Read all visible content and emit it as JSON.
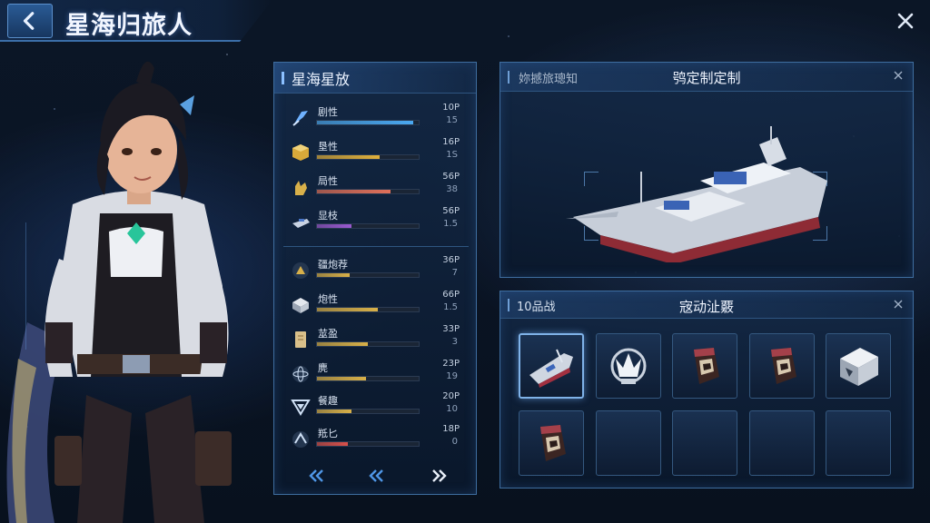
{
  "header": {
    "title": "星海归旅人"
  },
  "stats_panel": {
    "title": "星海星放",
    "stats": [
      {
        "name": "剧性",
        "value": "10P",
        "sub": "15",
        "fill": 0.95,
        "color": "#4aa8f0"
      },
      {
        "name": "垦性",
        "value": "16P",
        "sub": "1S",
        "fill": 0.62,
        "color": "#e0b03c"
      },
      {
        "name": "局性",
        "value": "56P",
        "sub": "38",
        "fill": 0.72,
        "color": "#e0705a"
      },
      {
        "name": "显枝",
        "value": "56P",
        "sub": "1.5",
        "fill": 0.34,
        "color": "#9a5ad0"
      },
      {
        "name": "疆炮荐",
        "value": "36P",
        "sub": "7",
        "fill": 0.32,
        "color": "#d8b048"
      },
      {
        "name": "炮性",
        "value": "66P",
        "sub": "1.5",
        "fill": 0.6,
        "color": "#d8b048"
      },
      {
        "name": "莁盈",
        "value": "33P",
        "sub": "3",
        "fill": 0.5,
        "color": "#d8b048"
      },
      {
        "name": "麂",
        "value": "23P",
        "sub": "19",
        "fill": 0.48,
        "color": "#d8b048"
      },
      {
        "name": "餐趣",
        "value": "20P",
        "sub": "10",
        "fill": 0.34,
        "color": "#d8b048"
      },
      {
        "name": "羝匕",
        "value": "18P",
        "sub": "0",
        "fill": 0.3,
        "color": "#d8504a"
      }
    ],
    "icons": [
      "blade-icon",
      "cube-icon",
      "hand-icon",
      "ship-icon",
      "turret-icon",
      "crate-icon",
      "scroll-icon",
      "atom-icon",
      "emblem-icon",
      "orbit-icon"
    ]
  },
  "ship_panel": {
    "left_label": "妳撼旅璁知",
    "title": "鸮定制定制"
  },
  "items_panel": {
    "left_label": "10品战",
    "title": "宼动沚覈",
    "slots": [
      {
        "item": "warship-item",
        "selected": true
      },
      {
        "item": "crown-emblem-item",
        "selected": false
      },
      {
        "item": "armor-gauntlet-item",
        "selected": false
      },
      {
        "item": "armor-gauntlet-item",
        "selected": false
      },
      {
        "item": "steel-crate-item",
        "selected": false
      },
      {
        "item": "armor-gauntlet-item",
        "selected": false
      },
      {
        "item": "empty",
        "selected": false
      },
      {
        "item": "empty",
        "selected": false
      },
      {
        "item": "empty",
        "selected": false
      },
      {
        "item": "empty",
        "selected": false
      }
    ]
  }
}
